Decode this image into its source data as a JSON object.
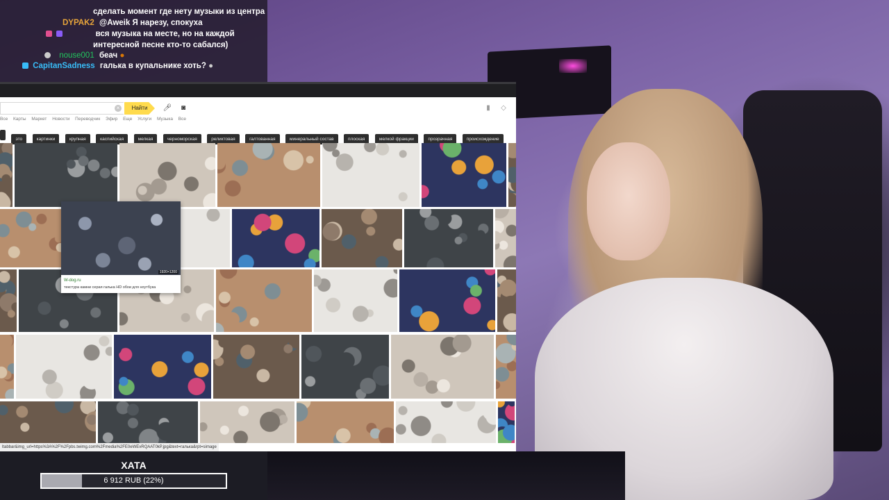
{
  "chat": {
    "messages": [
      {
        "user": "",
        "user_color": "#ffffff",
        "text": "сделать момент где нету музыки из центра"
      },
      {
        "user": "DYPAK2",
        "user_color": "#e8a53a",
        "text": "@Aweik Я нарезу, спокуха"
      },
      {
        "user": "",
        "user_color": "#3b5bff",
        "text": "вся музыка на месте, но на каждой"
      },
      {
        "user": "",
        "user_color": "#ffffff",
        "text": "интересной песне кто-то сабался)"
      },
      {
        "user": "nouse001",
        "user_color": "#22c55e",
        "text": "беач"
      },
      {
        "user": "CapitanSadness",
        "user_color": "#38bdf8",
        "text": "галька в купальнике хоть?"
      }
    ]
  },
  "browser": {
    "search_value": "",
    "find_button": "Найти",
    "nav_items": [
      "Все",
      "Карты",
      "Маркет",
      "Новости",
      "Переводчик",
      "Эфир",
      "Еще",
      "Услуги",
      "Музыка",
      "Все"
    ],
    "tags": [
      "",
      "это",
      "картинки",
      "крупная",
      "каспийская",
      "мелкая",
      "черноморская",
      "реликтовая",
      "галтованная",
      "минеральный состав",
      "плоская",
      "мелкой фракции",
      "прозрачная",
      "происхождение"
    ],
    "preview": {
      "domain": "W-dog.ru",
      "caption": "текстура камни серая галька HD обои для ноутбука",
      "size": "1920×1200"
    },
    "status_url": "ltabbar&img_url=https%3A%2F%2Fpbs.twimg.com%2Fmedia%2FE0eWEvRQAAT0kP.jpg&text=галька&rpt=simage"
  },
  "donation": {
    "title": "ХАТА",
    "goal_text": "6 912 RUB (22%)",
    "progress_percent": 22,
    "colors": {
      "fill": "#a9a9b0",
      "border": "#ffffff"
    }
  }
}
